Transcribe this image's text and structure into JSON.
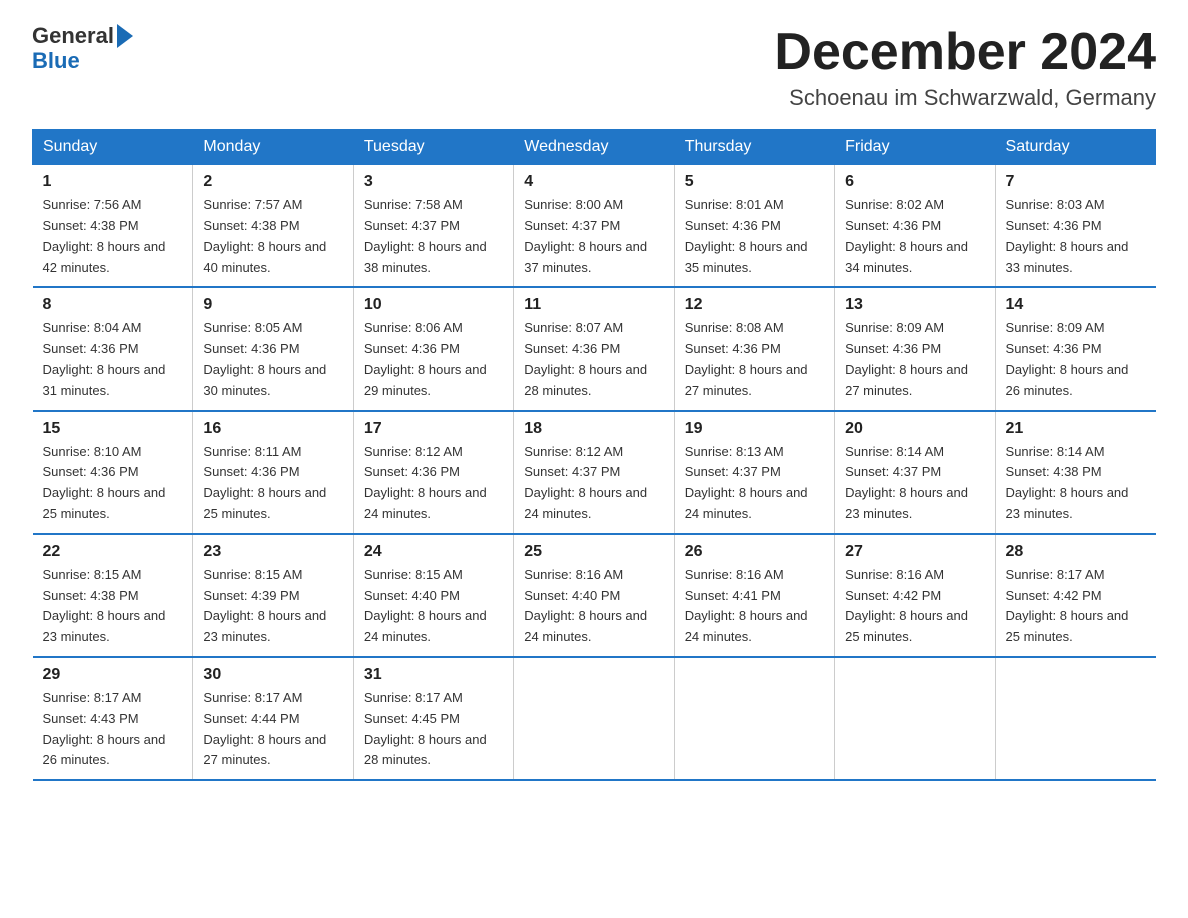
{
  "header": {
    "logo_general": "General",
    "logo_blue": "Blue",
    "month_title": "December 2024",
    "location": "Schoenau im Schwarzwald, Germany"
  },
  "weekdays": [
    "Sunday",
    "Monday",
    "Tuesday",
    "Wednesday",
    "Thursday",
    "Friday",
    "Saturday"
  ],
  "weeks": [
    [
      {
        "day": "1",
        "sunrise": "7:56 AM",
        "sunset": "4:38 PM",
        "daylight": "8 hours and 42 minutes."
      },
      {
        "day": "2",
        "sunrise": "7:57 AM",
        "sunset": "4:38 PM",
        "daylight": "8 hours and 40 minutes."
      },
      {
        "day": "3",
        "sunrise": "7:58 AM",
        "sunset": "4:37 PM",
        "daylight": "8 hours and 38 minutes."
      },
      {
        "day": "4",
        "sunrise": "8:00 AM",
        "sunset": "4:37 PM",
        "daylight": "8 hours and 37 minutes."
      },
      {
        "day": "5",
        "sunrise": "8:01 AM",
        "sunset": "4:36 PM",
        "daylight": "8 hours and 35 minutes."
      },
      {
        "day": "6",
        "sunrise": "8:02 AM",
        "sunset": "4:36 PM",
        "daylight": "8 hours and 34 minutes."
      },
      {
        "day": "7",
        "sunrise": "8:03 AM",
        "sunset": "4:36 PM",
        "daylight": "8 hours and 33 minutes."
      }
    ],
    [
      {
        "day": "8",
        "sunrise": "8:04 AM",
        "sunset": "4:36 PM",
        "daylight": "8 hours and 31 minutes."
      },
      {
        "day": "9",
        "sunrise": "8:05 AM",
        "sunset": "4:36 PM",
        "daylight": "8 hours and 30 minutes."
      },
      {
        "day": "10",
        "sunrise": "8:06 AM",
        "sunset": "4:36 PM",
        "daylight": "8 hours and 29 minutes."
      },
      {
        "day": "11",
        "sunrise": "8:07 AM",
        "sunset": "4:36 PM",
        "daylight": "8 hours and 28 minutes."
      },
      {
        "day": "12",
        "sunrise": "8:08 AM",
        "sunset": "4:36 PM",
        "daylight": "8 hours and 27 minutes."
      },
      {
        "day": "13",
        "sunrise": "8:09 AM",
        "sunset": "4:36 PM",
        "daylight": "8 hours and 27 minutes."
      },
      {
        "day": "14",
        "sunrise": "8:09 AM",
        "sunset": "4:36 PM",
        "daylight": "8 hours and 26 minutes."
      }
    ],
    [
      {
        "day": "15",
        "sunrise": "8:10 AM",
        "sunset": "4:36 PM",
        "daylight": "8 hours and 25 minutes."
      },
      {
        "day": "16",
        "sunrise": "8:11 AM",
        "sunset": "4:36 PM",
        "daylight": "8 hours and 25 minutes."
      },
      {
        "day": "17",
        "sunrise": "8:12 AM",
        "sunset": "4:36 PM",
        "daylight": "8 hours and 24 minutes."
      },
      {
        "day": "18",
        "sunrise": "8:12 AM",
        "sunset": "4:37 PM",
        "daylight": "8 hours and 24 minutes."
      },
      {
        "day": "19",
        "sunrise": "8:13 AM",
        "sunset": "4:37 PM",
        "daylight": "8 hours and 24 minutes."
      },
      {
        "day": "20",
        "sunrise": "8:14 AM",
        "sunset": "4:37 PM",
        "daylight": "8 hours and 23 minutes."
      },
      {
        "day": "21",
        "sunrise": "8:14 AM",
        "sunset": "4:38 PM",
        "daylight": "8 hours and 23 minutes."
      }
    ],
    [
      {
        "day": "22",
        "sunrise": "8:15 AM",
        "sunset": "4:38 PM",
        "daylight": "8 hours and 23 minutes."
      },
      {
        "day": "23",
        "sunrise": "8:15 AM",
        "sunset": "4:39 PM",
        "daylight": "8 hours and 23 minutes."
      },
      {
        "day": "24",
        "sunrise": "8:15 AM",
        "sunset": "4:40 PM",
        "daylight": "8 hours and 24 minutes."
      },
      {
        "day": "25",
        "sunrise": "8:16 AM",
        "sunset": "4:40 PM",
        "daylight": "8 hours and 24 minutes."
      },
      {
        "day": "26",
        "sunrise": "8:16 AM",
        "sunset": "4:41 PM",
        "daylight": "8 hours and 24 minutes."
      },
      {
        "day": "27",
        "sunrise": "8:16 AM",
        "sunset": "4:42 PM",
        "daylight": "8 hours and 25 minutes."
      },
      {
        "day": "28",
        "sunrise": "8:17 AM",
        "sunset": "4:42 PM",
        "daylight": "8 hours and 25 minutes."
      }
    ],
    [
      {
        "day": "29",
        "sunrise": "8:17 AM",
        "sunset": "4:43 PM",
        "daylight": "8 hours and 26 minutes."
      },
      {
        "day": "30",
        "sunrise": "8:17 AM",
        "sunset": "4:44 PM",
        "daylight": "8 hours and 27 minutes."
      },
      {
        "day": "31",
        "sunrise": "8:17 AM",
        "sunset": "4:45 PM",
        "daylight": "8 hours and 28 minutes."
      },
      null,
      null,
      null,
      null
    ]
  ],
  "colors": {
    "header_bg": "#2176c7",
    "header_text": "#ffffff",
    "border": "#2176c7"
  }
}
